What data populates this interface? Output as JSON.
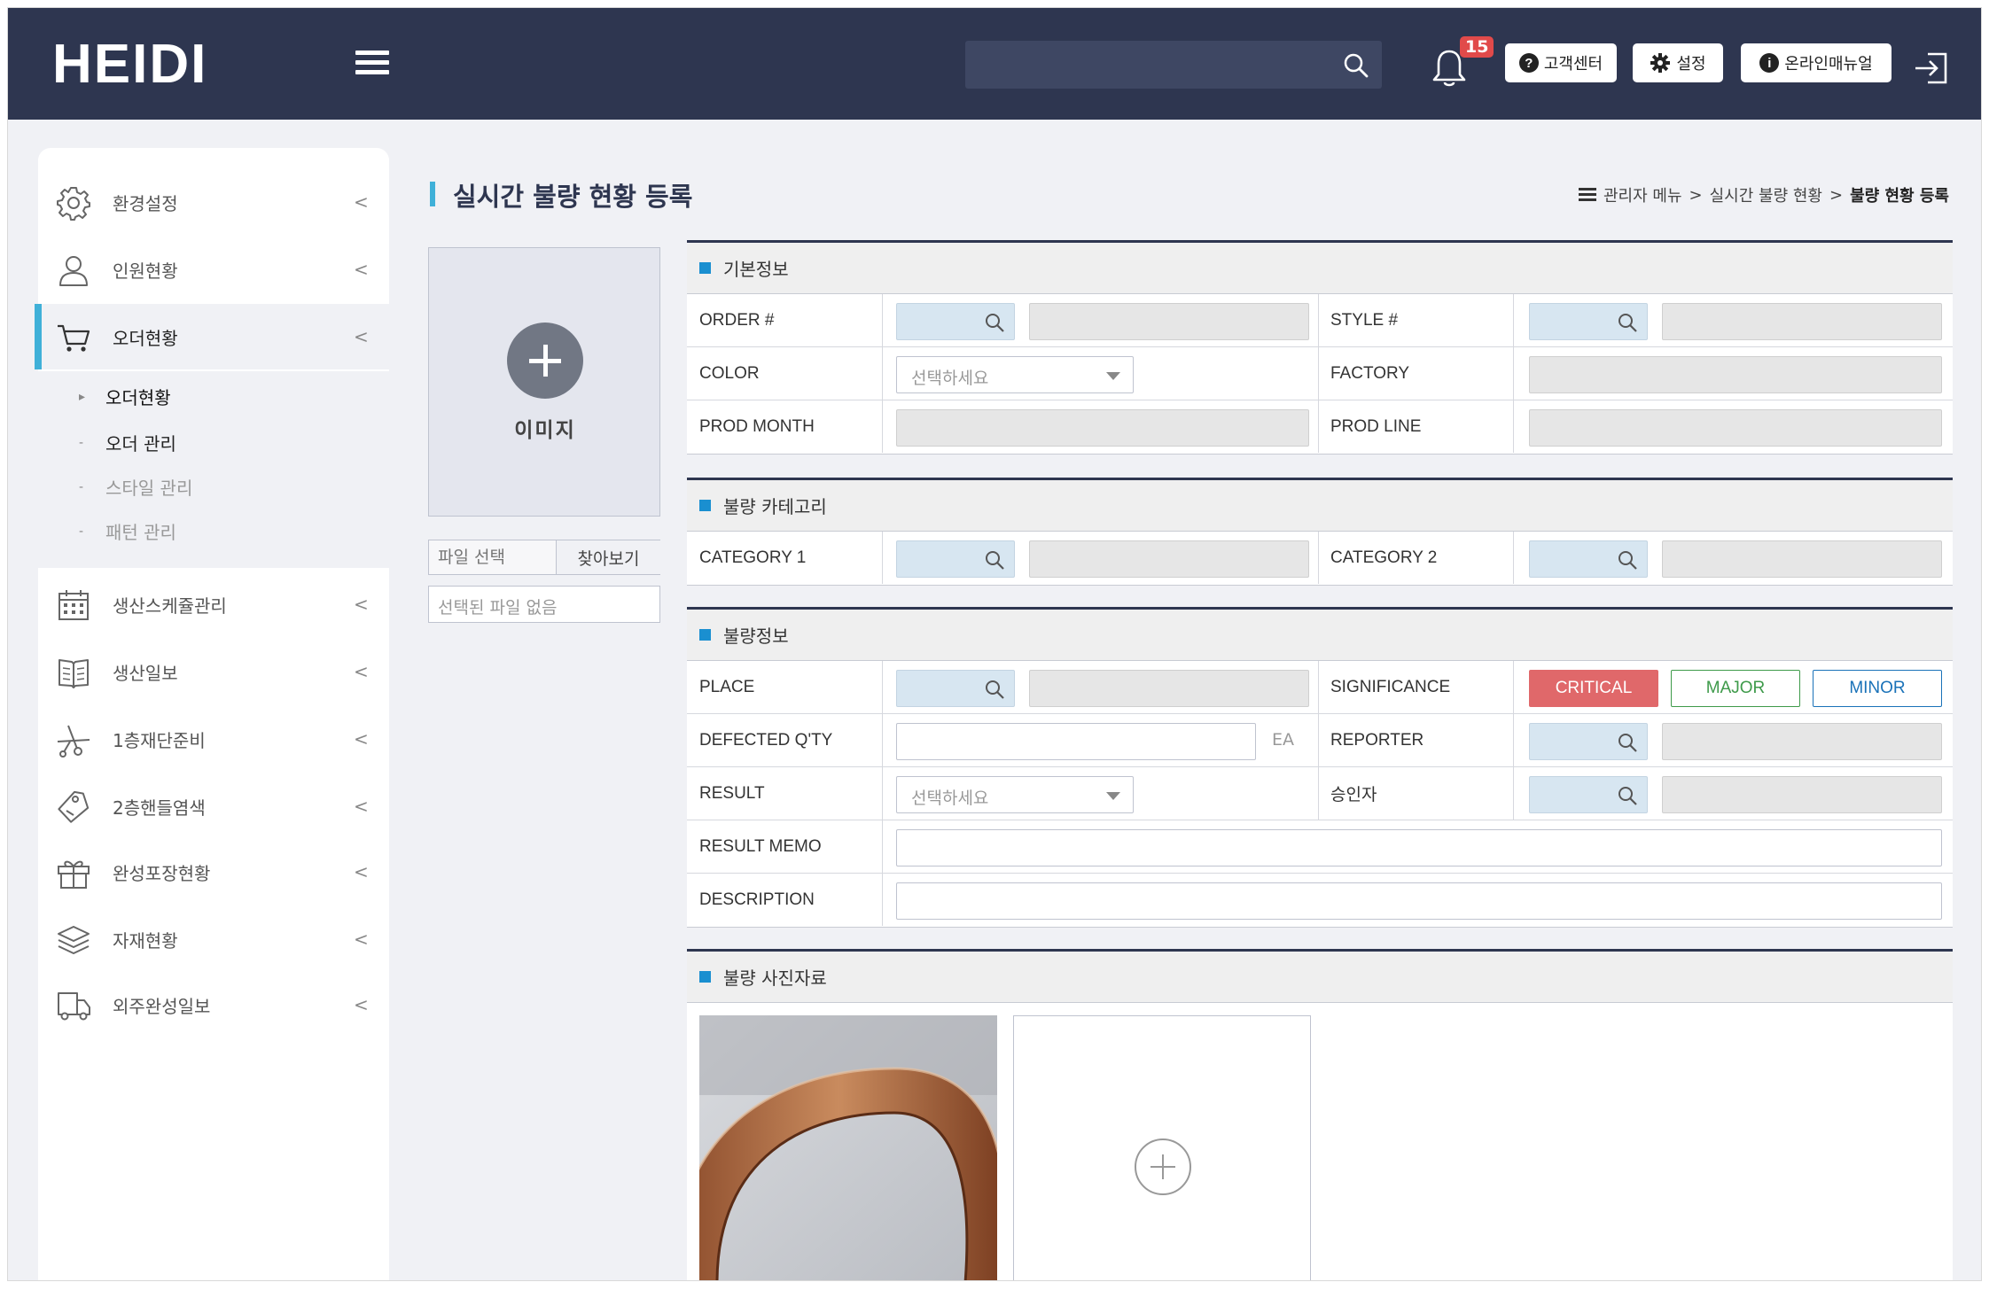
{
  "header": {
    "logo": "HEIDI",
    "search_placeholder": "",
    "notification_count": "15",
    "buttons": {
      "support": "고객센터",
      "settings": "설정",
      "manual": "온라인매뉴얼"
    },
    "icons": [
      "menu-icon",
      "search-icon",
      "bell-icon",
      "help-icon",
      "gear-icon",
      "info-icon",
      "logout-icon"
    ]
  },
  "sidebar": {
    "items": [
      {
        "label": "환경설정",
        "icon": "gear-icon"
      },
      {
        "label": "인원현황",
        "icon": "user-icon"
      },
      {
        "label": "오더현황",
        "icon": "cart-icon",
        "active": true
      },
      {
        "label": "생산스케쥴관리",
        "icon": "calendar-icon"
      },
      {
        "label": "생산일보",
        "icon": "book-icon"
      },
      {
        "label": "1층재단준비",
        "icon": "scissors-icon"
      },
      {
        "label": "2층핸들염색",
        "icon": "tag-icon"
      },
      {
        "label": "완성포장현황",
        "icon": "gift-icon"
      },
      {
        "label": "자재현황",
        "icon": "layers-icon"
      },
      {
        "label": "외주완성일보",
        "icon": "truck-icon"
      }
    ],
    "submenu": [
      {
        "label": "오더현황"
      },
      {
        "label": "오더 관리"
      },
      {
        "label": "스타일 관리"
      },
      {
        "label": "패턴 관리"
      }
    ]
  },
  "page": {
    "title": "실시간 불량 현황 등록",
    "breadcrumb": {
      "root": "관리자 메뉴",
      "sep1": ">",
      "middle": "실시간 불량 현황",
      "sep2": ">",
      "current": "불량 현황 등록"
    }
  },
  "image_upload": {
    "label": "이미지",
    "file_placeholder": "파일 선택",
    "browse": "찾아보기",
    "no_file": "선택된 파일 없음"
  },
  "sections": {
    "basic": {
      "title": "기본정보",
      "order": "ORDER #",
      "style": "STYLE #",
      "color": "COLOR",
      "color_select": "선택하세요",
      "factory": "FACTORY",
      "prod_month": "PROD MONTH",
      "prod_line": "PROD LINE"
    },
    "category": {
      "title": "불량 카테고리",
      "cat1": "CATEGORY 1",
      "cat2": "CATEGORY 2"
    },
    "defect": {
      "title": "불량정보",
      "place": "PLACE",
      "significance": "SIGNIFICANCE",
      "sig_critical": "CRITICAL",
      "sig_major": "MAJOR",
      "sig_minor": "MINOR",
      "qty": "DEFECTED Q'TY",
      "unit": "EA",
      "reporter": "REPORTER",
      "result": "RESULT",
      "result_select": "선택하세요",
      "approver": "승인자",
      "result_memo": "RESULT MEMO",
      "description": "DESCRIPTION"
    },
    "photos": {
      "title": "불량 사진자료"
    }
  },
  "colors": {
    "header_bg": "#2e3650",
    "accent": "#3fb0d8",
    "section_marker": "#1a8fd0",
    "critical": "#e0686a",
    "major": "#3e9a4a",
    "minor": "#1a72b8",
    "badge": "#e14a4a"
  }
}
